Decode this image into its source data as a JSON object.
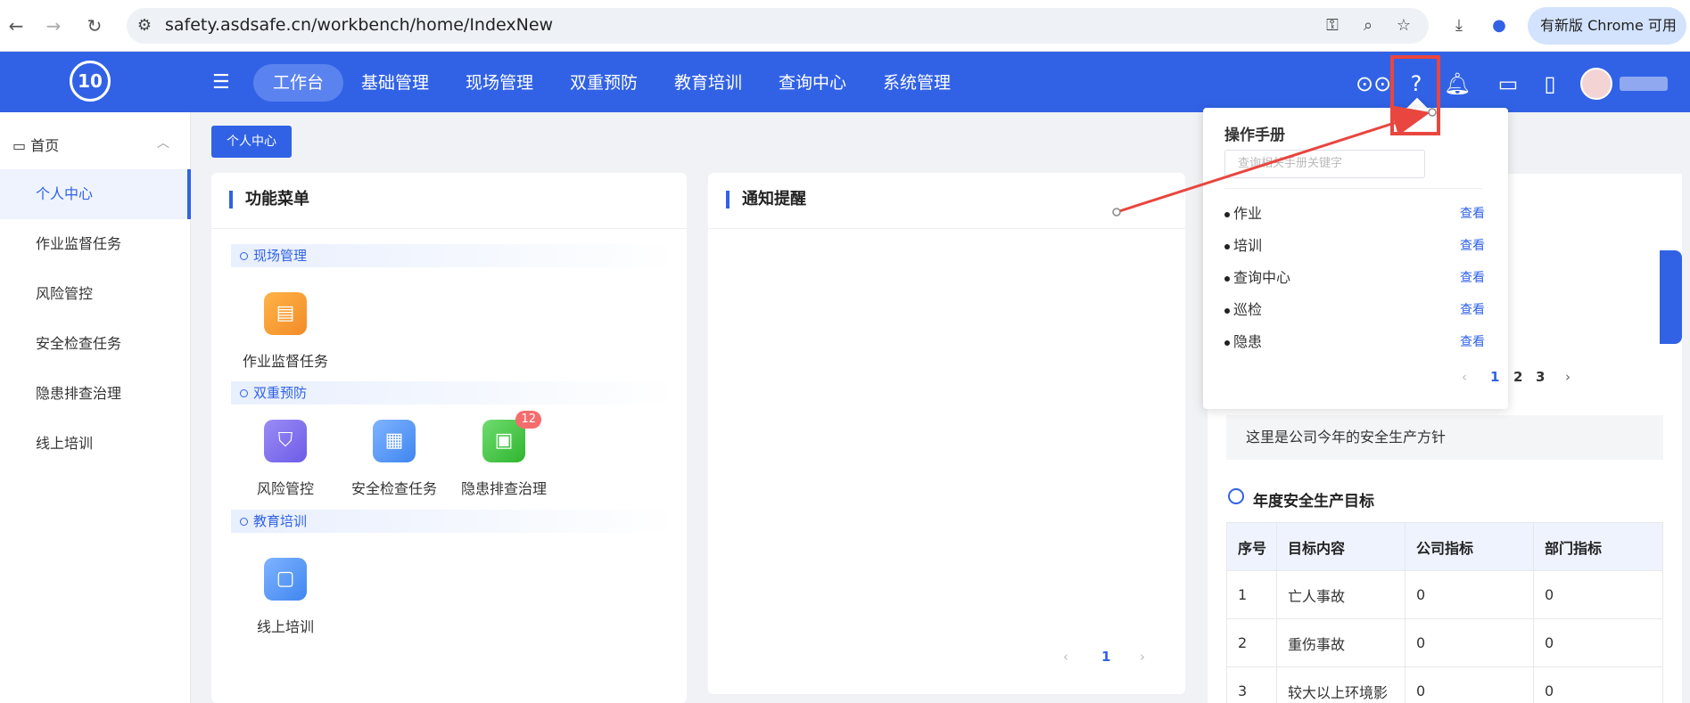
{
  "browser": {
    "url": "safety.asdsafe.cn/workbench/home/IndexNew",
    "update_text": "有新版 Chrome 可用"
  },
  "header": {
    "logo_text": "10",
    "nav": [
      "工作台",
      "基础管理",
      "现场管理",
      "双重预防",
      "教育培训",
      "查询中心",
      "系统管理"
    ]
  },
  "sidebar": {
    "home": "首页",
    "items": [
      "个人中心",
      "作业监督任务",
      "风险管控",
      "安全检查任务",
      "隐患排查治理",
      "线上培训"
    ]
  },
  "tag_button": "个人中心",
  "function_menu": {
    "title": "功能菜单",
    "sections": [
      {
        "title": "现场管理",
        "apps": [
          {
            "label": "作业监督任务"
          }
        ]
      },
      {
        "title": "双重预防",
        "apps": [
          {
            "label": "风险管控"
          },
          {
            "label": "安全检查任务"
          },
          {
            "label": "隐患排查治理",
            "badge": "12"
          }
        ]
      },
      {
        "title": "教育培训",
        "apps": [
          {
            "label": "线上培训"
          }
        ]
      }
    ]
  },
  "notice": {
    "title": "通知提醒",
    "pager": {
      "prev": "‹",
      "current": "1",
      "next": "›"
    }
  },
  "right_panel": {
    "policy_text": "这里是公司今年的安全生产方针",
    "goals_title": "年度安全生产目标",
    "table_headers": [
      "序号",
      "目标内容",
      "公司指标",
      "部门指标"
    ],
    "rows": [
      [
        "1",
        "亡人事故",
        "0",
        "0"
      ],
      [
        "2",
        "重伤事故",
        "0",
        "0"
      ],
      [
        "3",
        "较大以上环境影",
        "0",
        "0"
      ]
    ]
  },
  "manual_popup": {
    "title": "操作手册",
    "search_placeholder": "查询相关手册关键字",
    "items": [
      {
        "label": "作业",
        "action": "查看"
      },
      {
        "label": "培训",
        "action": "查看"
      },
      {
        "label": "查询中心",
        "action": "查看"
      },
      {
        "label": "巡检",
        "action": "查看"
      },
      {
        "label": "隐患",
        "action": "查看"
      }
    ],
    "pages": [
      "1",
      "2",
      "3"
    ]
  },
  "colors": {
    "primary": "#3162e6",
    "annotation": "#e8463f"
  }
}
